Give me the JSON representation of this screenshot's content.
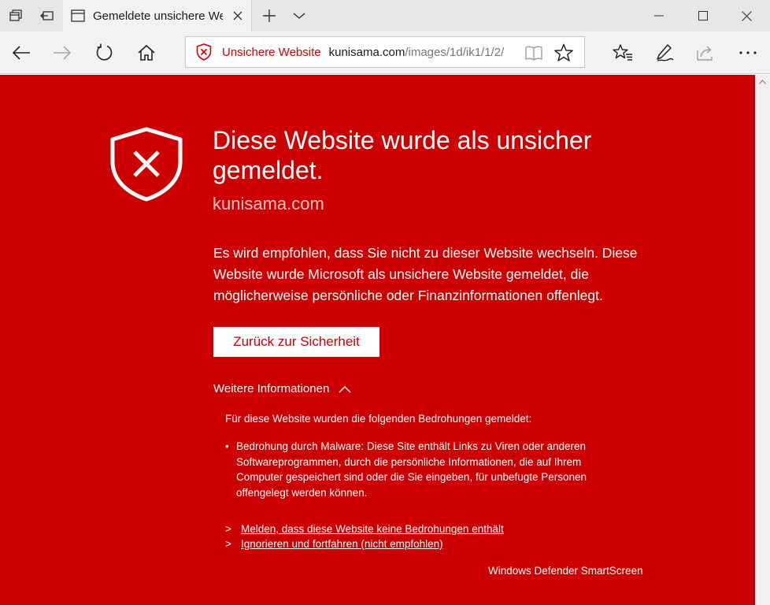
{
  "tab": {
    "title": "Gemeldete unsichere Website"
  },
  "addressbar": {
    "status_label": "Unsichere Website",
    "url_domain": "kunisama.com",
    "url_path": "/images/1d/ik1/1/2/"
  },
  "icons": {
    "tab_manager": "tab-manager-icon",
    "set_aside": "set-aside-tabs-icon",
    "new_tab": "plus-icon",
    "tab_list": "chevron-down-icon",
    "minimize": "minimize-icon",
    "maximize": "maximize-icon",
    "close": "close-icon",
    "back": "back-arrow-icon",
    "forward": "forward-arrow-icon",
    "refresh": "refresh-icon",
    "home": "home-icon",
    "reading_view": "book-icon",
    "favorite": "star-icon",
    "favorites_hub": "favorites-list-icon",
    "notes": "pen-icon",
    "share": "share-icon",
    "more": "more-icon"
  },
  "page": {
    "headline": "Diese Website wurde als unsicher gemeldet.",
    "domain": "kunisama.com",
    "paragraph": "Es wird empfohlen, dass Sie nicht zu dieser Website wechseln. Diese Website wurde Microsoft als unsichere Website gemeldet, die möglicherweise persönliche oder Finanzinformationen offenlegt.",
    "back_button": "Zurück zur Sicherheit",
    "more_info": "Weitere Informationen",
    "threats_intro": "Für diese Website wurden die folgenden Bedrohungen gemeldet:",
    "bullet_marker": "•",
    "threat_text": "Bedrohung durch Malware: Diese Site enthält Links zu Viren oder anderen Softwareprogrammen, durch die persönliche Informationen, die auf Ihrem Computer gespeichert sind oder die Sie eingeben, für unbefugte Personen offengelegt werden können.",
    "link_marker": ">",
    "link_report": "Melden, dass diese Website keine Bedrohungen enthält",
    "link_ignore": "Ignorieren und fortfahren (nicht empfohlen)",
    "footer": "Windows Defender SmartScreen"
  },
  "colors": {
    "warning_red": "#cc0000",
    "address_red": "#d00000",
    "domain_pink": "#f6c5c5"
  }
}
